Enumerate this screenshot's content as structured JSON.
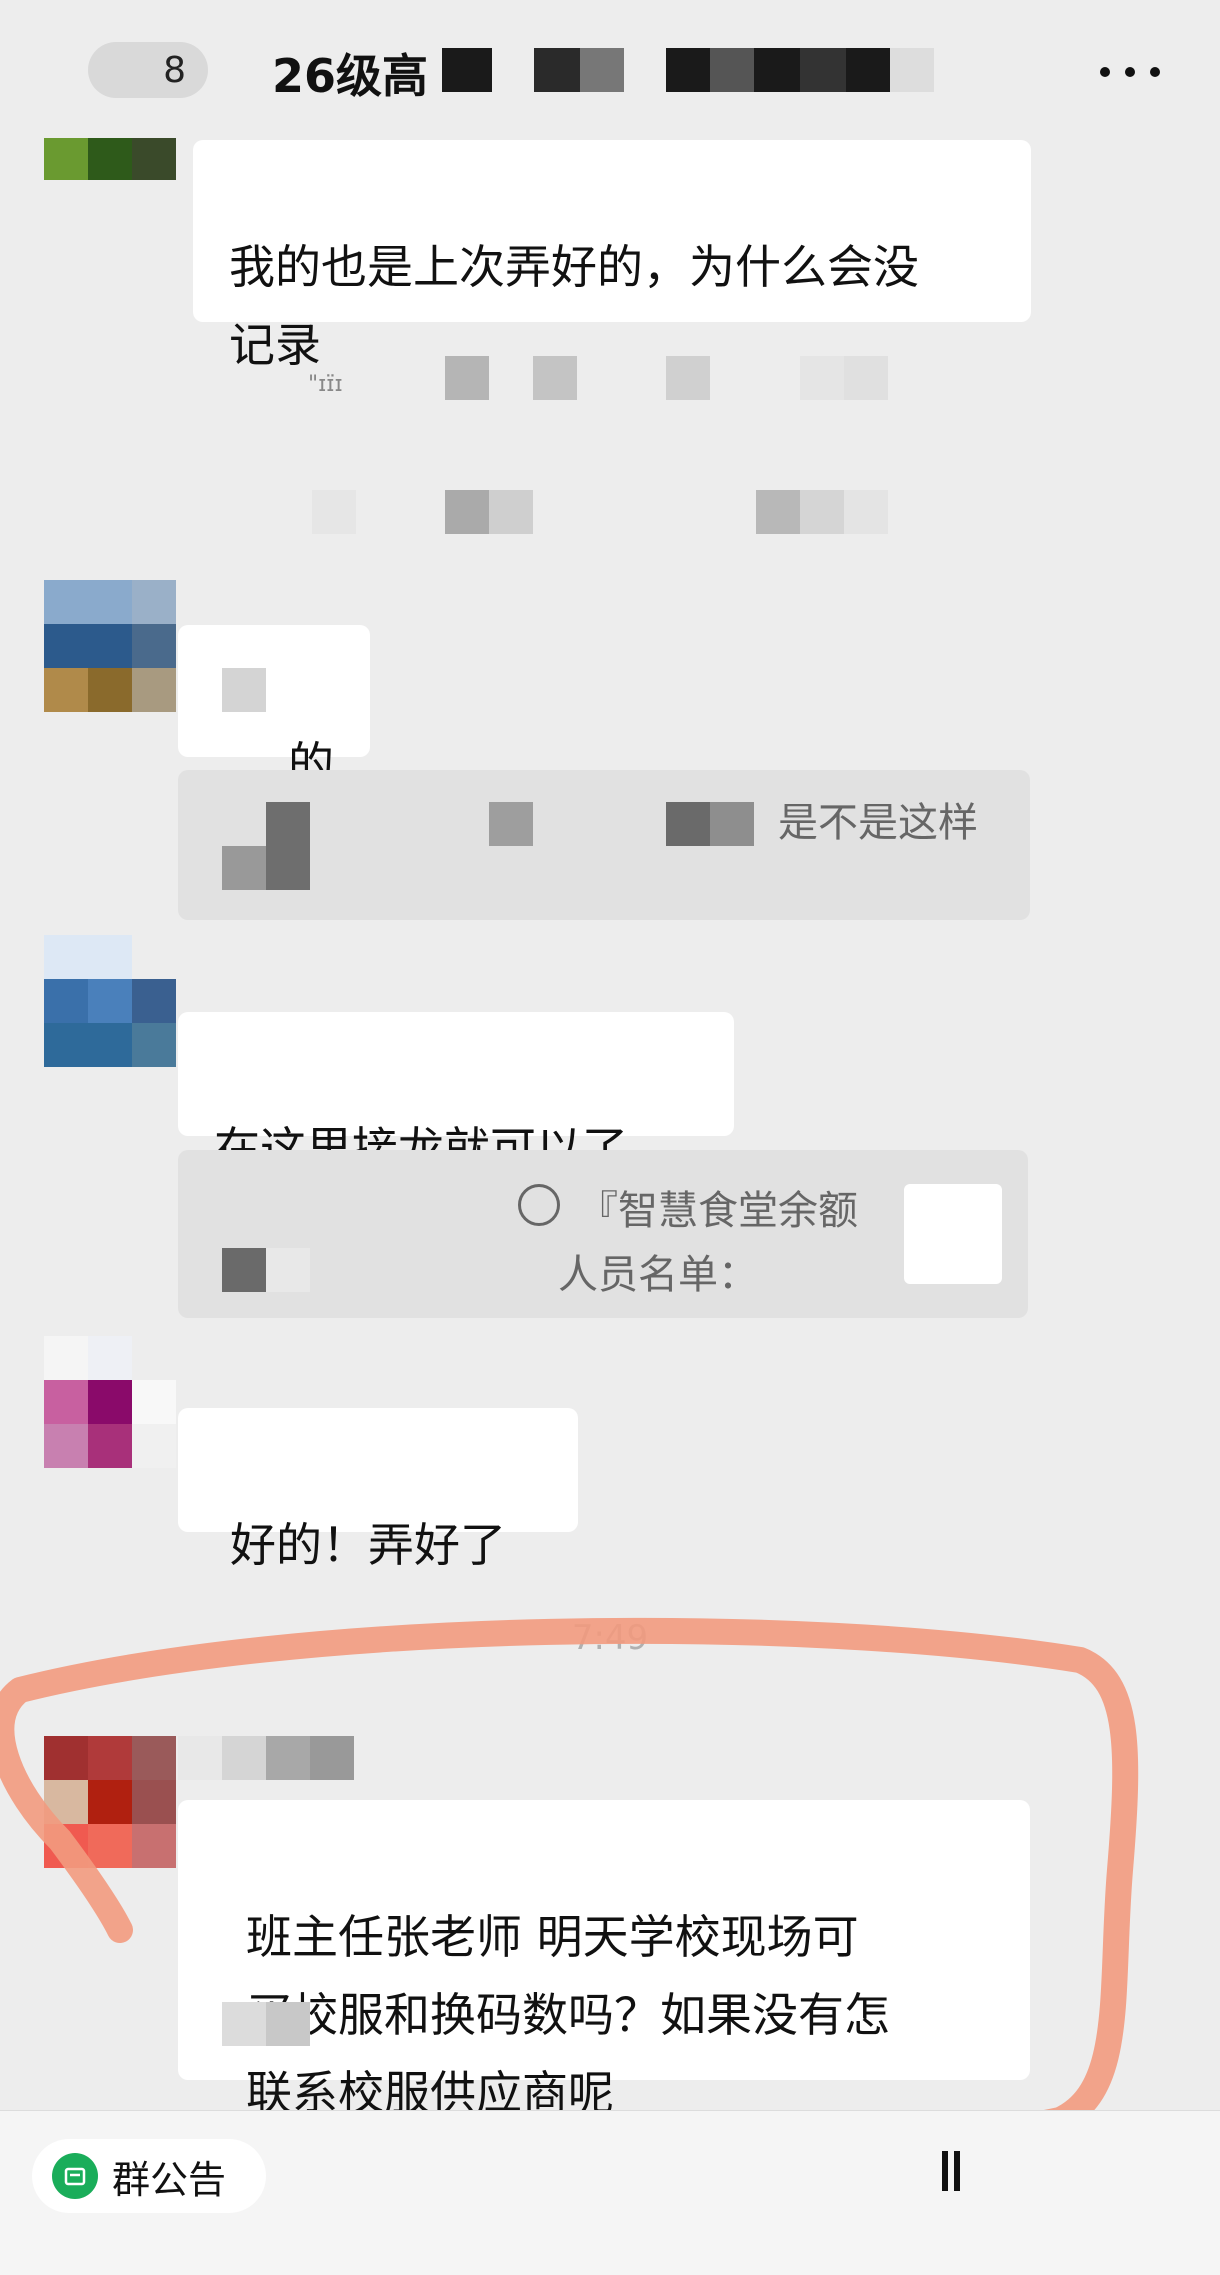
{
  "header": {
    "back_count": "8",
    "title": "26级高",
    "more_label": "更多"
  },
  "messages": [
    {
      "text": "我的也是上次弄好的，为什么会没\n记录"
    },
    {
      "text": "的"
    },
    {
      "quote_text": "是不是这样"
    },
    {
      "text": "在这里接龙就可以了"
    },
    {
      "quote_line1": "『智慧食堂余额",
      "quote_line2": "人员名单："
    },
    {
      "text": "好的！弄好了"
    },
    {
      "text": "班主任张老师  明天学校现场可\n买校服和换码数吗？如果没有怎\n联系校服供应商呢"
    }
  ],
  "timestamp": "7:49",
  "bottom_bar": {
    "notice_label": "群公告"
  },
  "colors": {
    "background": "#ededed",
    "bubble": "#ffffff",
    "quote": "#e1e1e1",
    "annotation": "#f29a7e",
    "notice_icon": "#1aad5a"
  }
}
